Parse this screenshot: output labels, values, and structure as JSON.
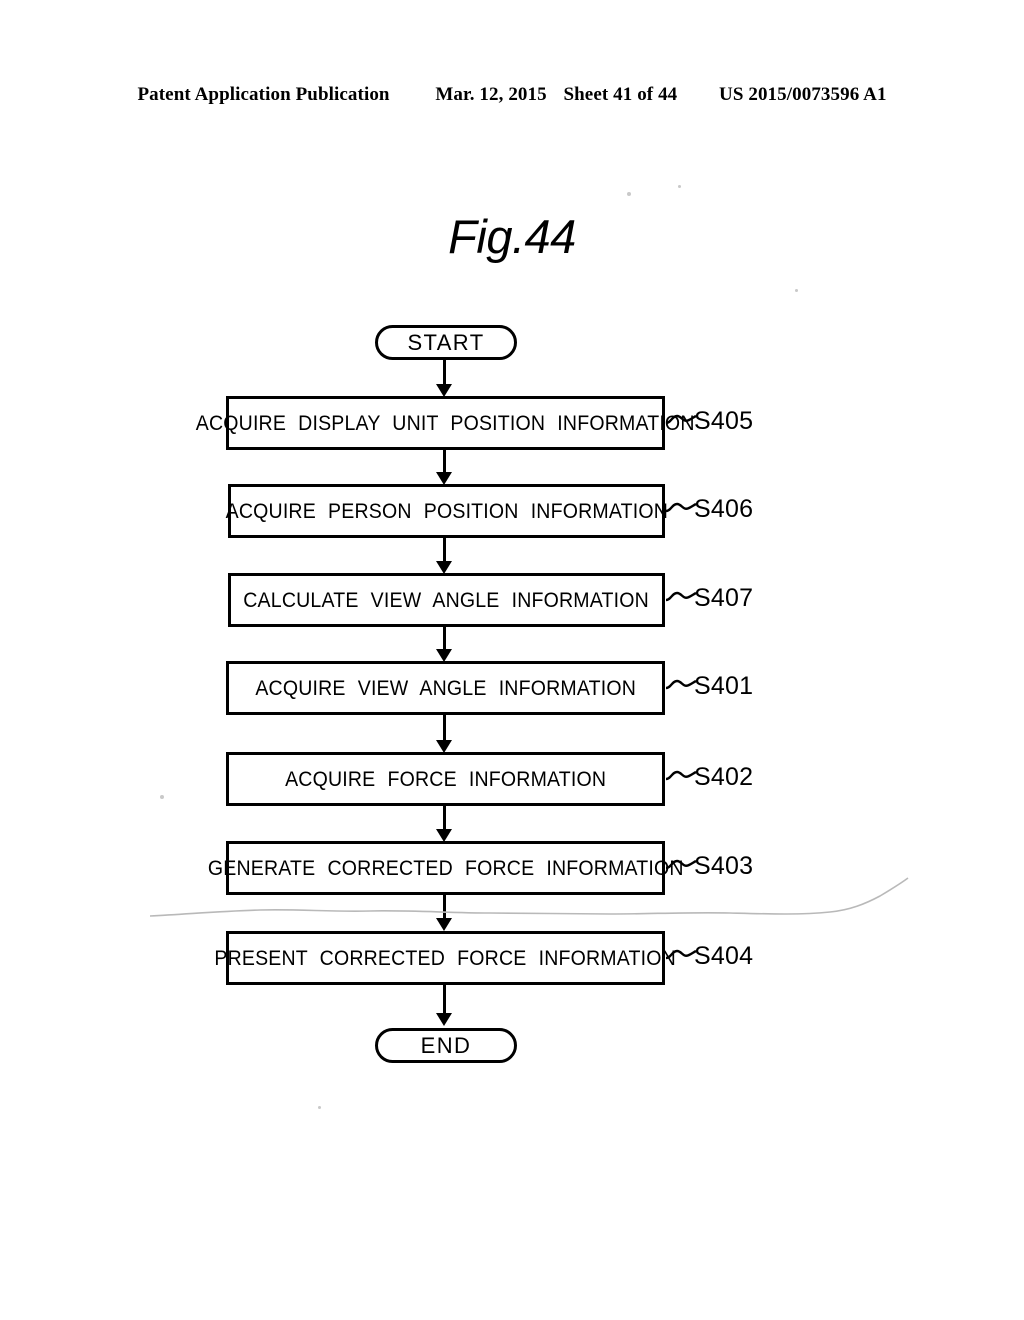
{
  "header": {
    "publication": "Patent Application Publication",
    "date": "Mar. 12, 2015",
    "sheet": "Sheet 41 of 44",
    "patent_number": "US 2015/0073596 A1"
  },
  "figure": {
    "title": "Fig.44"
  },
  "flowchart": {
    "start_label": "START",
    "end_label": "END",
    "steps": [
      {
        "text": "ACQUIRE DISPLAY UNIT POSITION INFORMATION",
        "ref": "S405"
      },
      {
        "text": "ACQUIRE PERSON POSITION INFORMATION",
        "ref": "S406"
      },
      {
        "text": "CALCULATE VIEW ANGLE INFORMATION",
        "ref": "S407"
      },
      {
        "text": "ACQUIRE VIEW ANGLE INFORMATION",
        "ref": "S401"
      },
      {
        "text": "ACQUIRE FORCE INFORMATION",
        "ref": "S402"
      },
      {
        "text": "GENERATE CORRECTED FORCE INFORMATION",
        "ref": "S403"
      },
      {
        "text": "PRESENT CORRECTED FORCE INFORMATION",
        "ref": "S404"
      }
    ]
  },
  "colors": {
    "ink": "#000000",
    "page": "#ffffff",
    "artifact": "#b9b9b9"
  }
}
